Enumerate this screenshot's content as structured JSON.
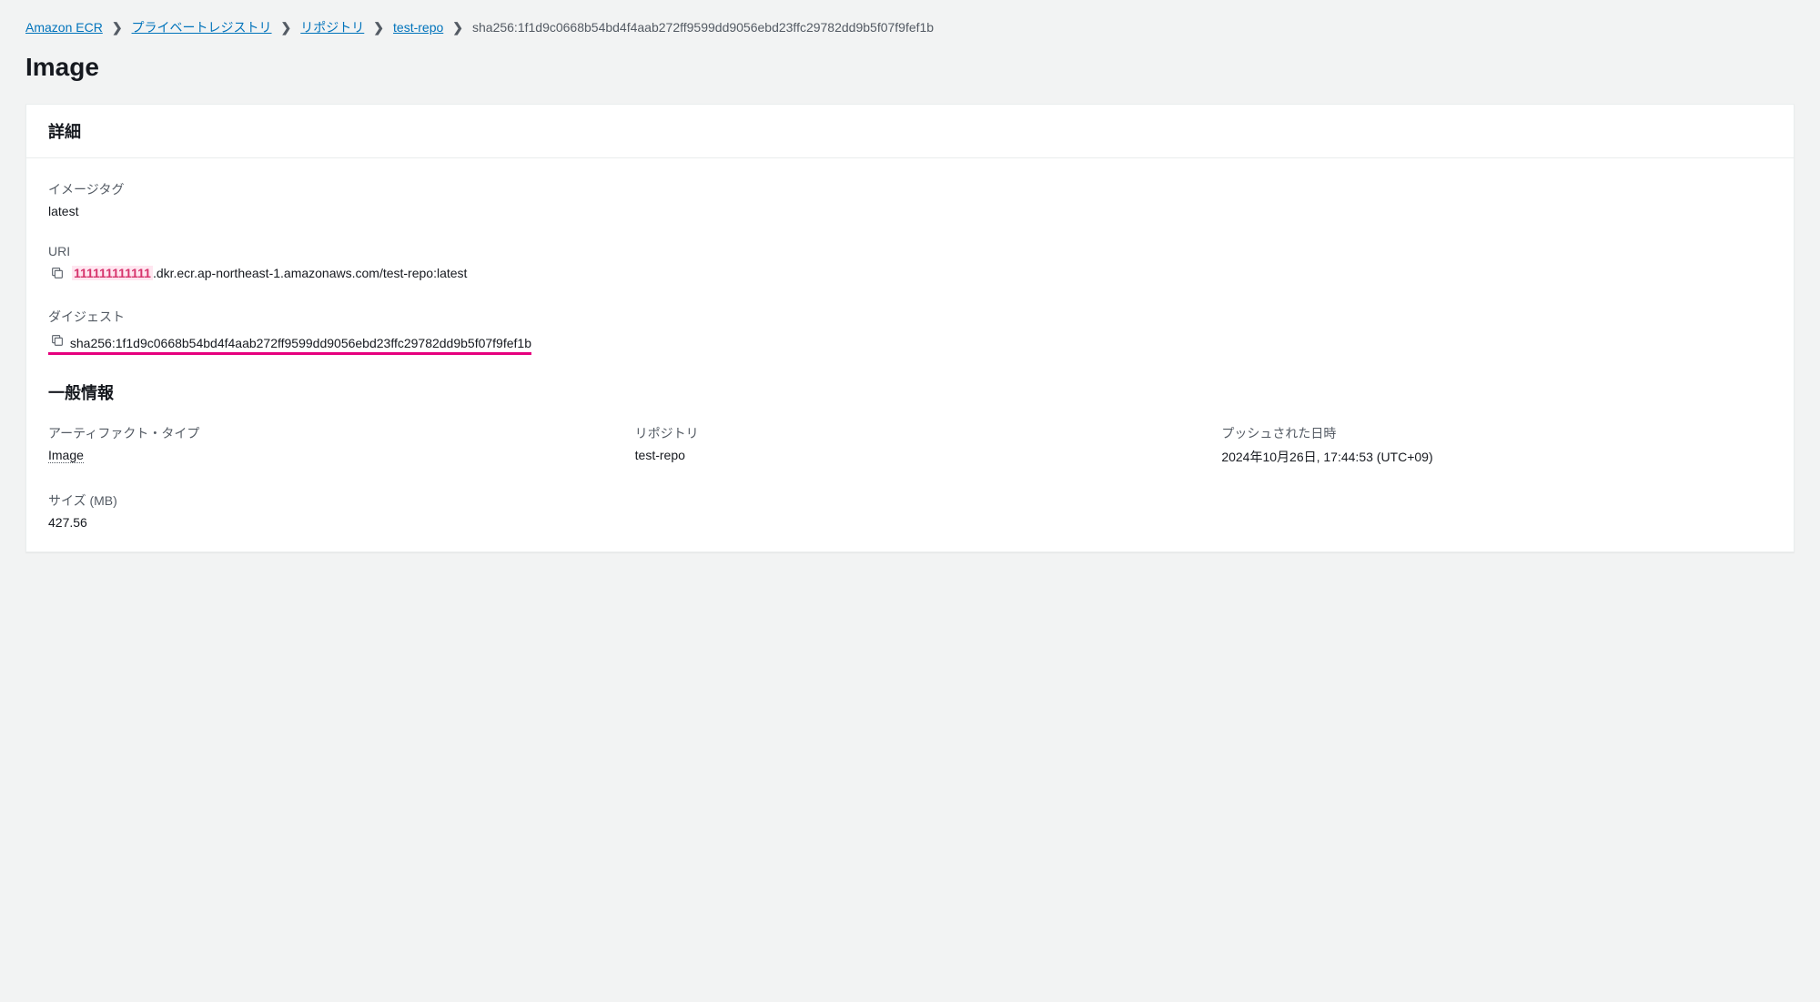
{
  "breadcrumb": {
    "items": [
      {
        "label": "Amazon ECR",
        "link": true
      },
      {
        "label": "プライベートレジストリ",
        "link": true
      },
      {
        "label": "リポジトリ",
        "link": true
      },
      {
        "label": "test-repo",
        "link": true
      }
    ],
    "current": "sha256:1f1d9c0668b54bd4f4aab272ff9599dd9056ebd23ffc29782dd9b5f07f9fef1b"
  },
  "page_title": "Image",
  "panel": {
    "header": "詳細",
    "image_tag": {
      "label": "イメージタグ",
      "value": "latest"
    },
    "uri": {
      "label": "URI",
      "account": "111111111111",
      "rest": ".dkr.ecr.ap-northeast-1.amazonaws.com/test-repo:latest"
    },
    "digest": {
      "label": "ダイジェスト",
      "value": "sha256:1f1d9c0668b54bd4f4aab272ff9599dd9056ebd23ffc29782dd9b5f07f9fef1b"
    },
    "general_info": {
      "title": "一般情報",
      "artifact_type": {
        "label": "アーティファクト・タイプ",
        "value": "Image"
      },
      "repository": {
        "label": "リポジトリ",
        "value": "test-repo"
      },
      "pushed_at": {
        "label": "プッシュされた日時",
        "value": "2024年10月26日, 17:44:53 (UTC+09)"
      },
      "size": {
        "label": "サイズ (MB)",
        "value": "427.56"
      }
    }
  }
}
